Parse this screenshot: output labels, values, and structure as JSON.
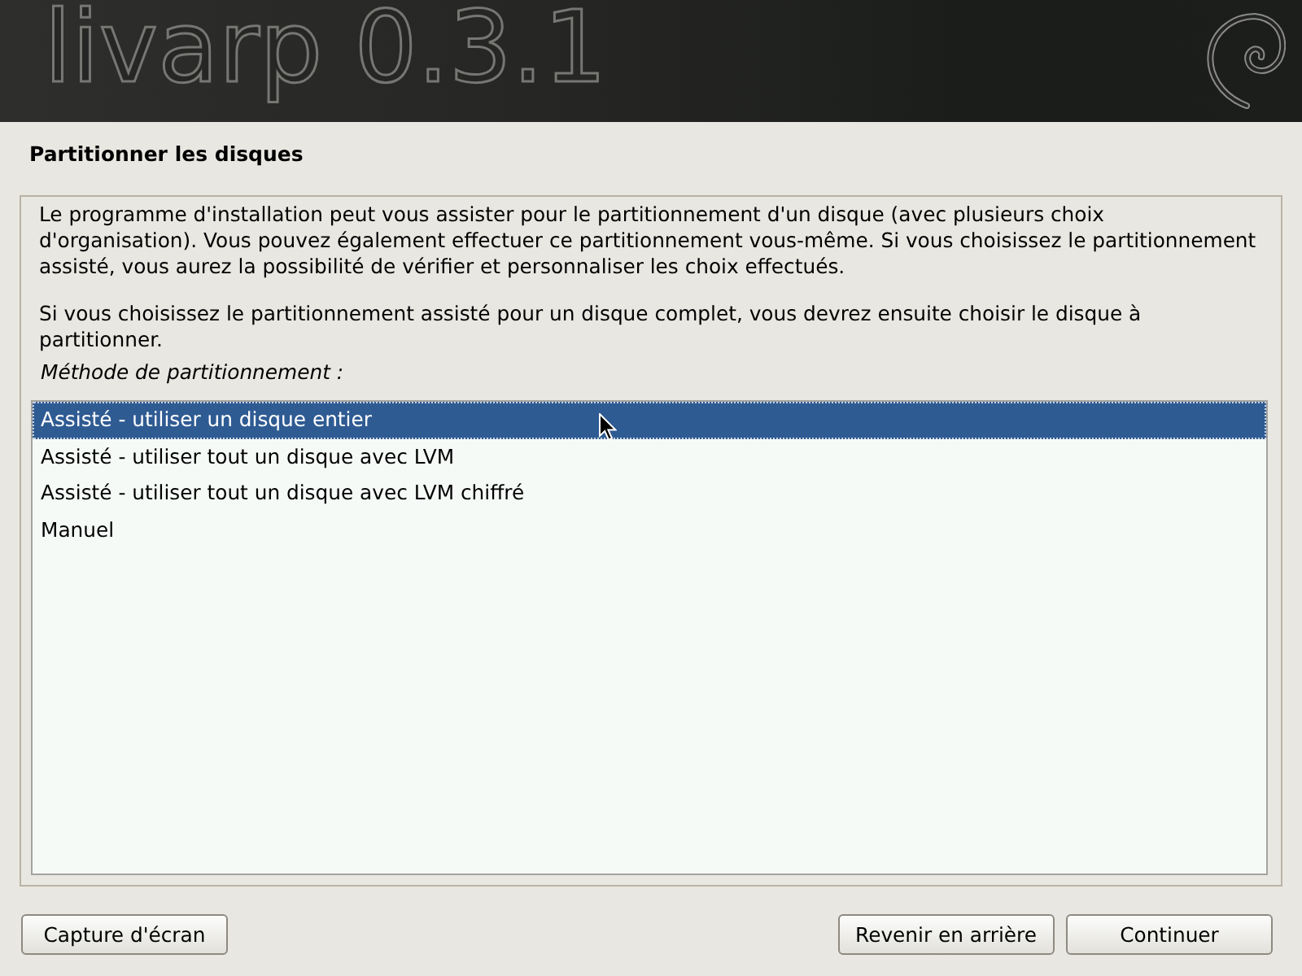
{
  "banner": {
    "title": "livarp 0.3.1"
  },
  "page": {
    "title": "Partitionner les disques"
  },
  "description": [
    "Le programme d'installation peut vous assister pour le partitionnement d'un disque (avec plusieurs choix\nd'organisation). Vous pouvez également effectuer ce partitionnement vous-même. Si vous choisissez le partitionnement\nassisté, vous aurez la possibilité de vérifier et personnaliser les choix effectués.",
    "Si vous choisissez le partitionnement assisté pour un disque complet, vous devrez ensuite choisir le disque à\npartitionner."
  ],
  "list": {
    "label": "Méthode de partitionnement :",
    "items": [
      {
        "label": "Assisté - utiliser un disque entier",
        "selected": true
      },
      {
        "label": "Assisté - utiliser tout un disque avec LVM",
        "selected": false
      },
      {
        "label": "Assisté - utiliser tout un disque avec LVM chiffré",
        "selected": false
      },
      {
        "label": "Manuel",
        "selected": false
      }
    ]
  },
  "footer": {
    "left_buttons": [
      {
        "label": "Capture d'écran"
      }
    ],
    "right_buttons": [
      {
        "label": "Revenir en arrière"
      },
      {
        "label": "Continuer"
      }
    ]
  }
}
